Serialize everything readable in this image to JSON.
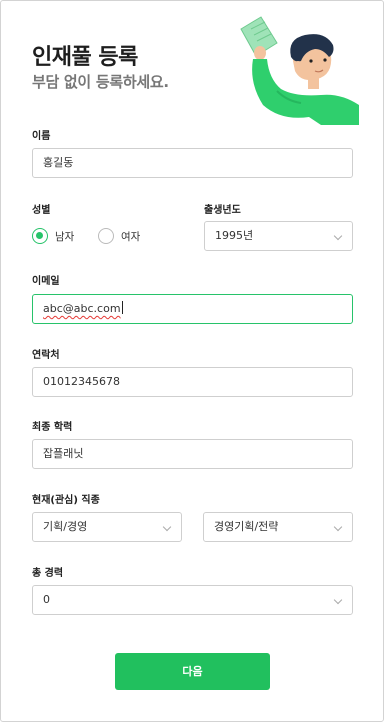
{
  "header": {
    "title": "인재풀 등록",
    "subtitle": "부담 없이 등록하세요."
  },
  "form": {
    "name": {
      "label": "이름",
      "value": "홍길동"
    },
    "gender": {
      "label": "성별",
      "options": [
        "남자",
        "여자"
      ],
      "selected": "남자"
    },
    "birth_year": {
      "label": "출생년도",
      "value": "1995년"
    },
    "email": {
      "label": "이메일",
      "value": "abc@abc.com"
    },
    "phone": {
      "label": "연락처",
      "value": "01012345678"
    },
    "education": {
      "label": "최종 학력",
      "value": "잡플래닛"
    },
    "job": {
      "label": "현재(관심) 직종",
      "category": "기획/경영",
      "subcategory": "경영기획/전략"
    },
    "career": {
      "label": "총 경력",
      "value": "0"
    }
  },
  "actions": {
    "next_label": "다음"
  },
  "colors": {
    "accent": "#21c05e",
    "border": "#cfcfcf",
    "active_border": "#27c36a"
  },
  "icons": [
    "person-holding-paper-illustration",
    "chevron-down-icon"
  ]
}
